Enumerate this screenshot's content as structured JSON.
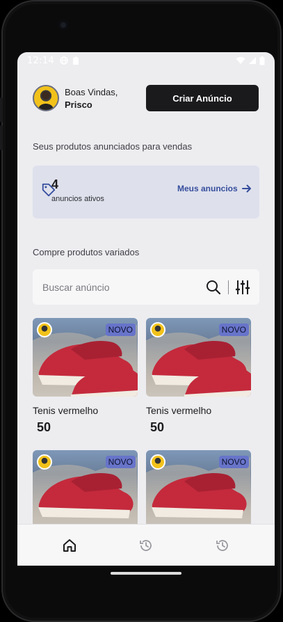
{
  "status_bar": {
    "time": "12:14",
    "left_icons": [
      "globe-icon",
      "clipboard-icon"
    ],
    "right_icons": [
      "wifi-icon",
      "signal-icon",
      "battery-icon"
    ]
  },
  "header": {
    "greeting": "Boas Vindas,",
    "user_name": "Prisco",
    "create_button": "Criar Anúncio"
  },
  "my_products": {
    "section_title": "Seus produtos anunciados para vendas",
    "count": "4",
    "count_label": "anuncios ativos",
    "link_label": "Meus anuncios"
  },
  "browse": {
    "section_title": "Compre produtos variados",
    "search_placeholder": "Buscar anúncio"
  },
  "products": [
    {
      "title": "Tenis vermelho",
      "price": "50",
      "badge": "NOVO"
    },
    {
      "title": "Tenis vermelho",
      "price": "50",
      "badge": "NOVO"
    },
    {
      "title": "",
      "price": "",
      "badge": "NOVO"
    },
    {
      "title": "",
      "price": "",
      "badge": "NOVO"
    }
  ],
  "tabbar": {
    "items": [
      "home-icon",
      "history-icon",
      "history-icon"
    ]
  },
  "colors": {
    "primary_dark": "#1a1a1d",
    "accent_blue": "#364d9d",
    "card_bg": "#dee1ec",
    "badge_bg": "#6774c9"
  }
}
